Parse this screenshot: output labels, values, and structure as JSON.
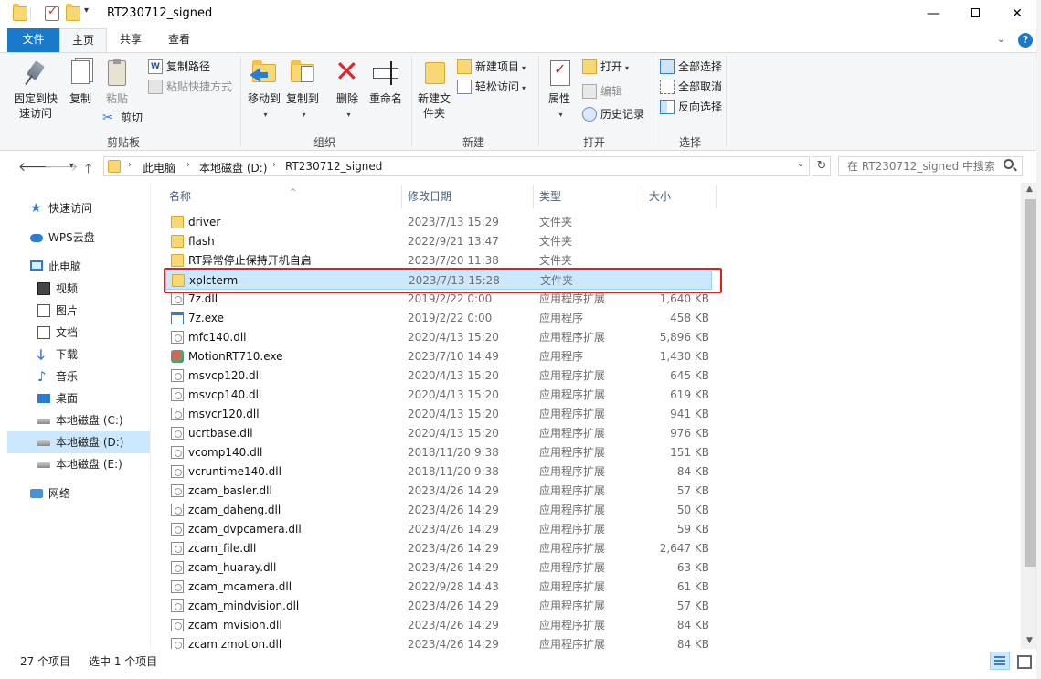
{
  "window": {
    "title": "RT230712_signed",
    "minimize": "—",
    "close": "✕"
  },
  "ribbon_tabs": [
    "文件",
    "主页",
    "共享",
    "查看"
  ],
  "ribbon": {
    "clipboard": {
      "label": "剪贴板",
      "pin": "固定到快速访问",
      "copy": "复制",
      "paste": "粘贴",
      "copy_path": "复制路径",
      "paste_shortcut": "粘贴快捷方式",
      "cut": "剪切"
    },
    "organize": {
      "label": "组织",
      "move_to": "移动到",
      "copy_to": "复制到",
      "delete": "删除",
      "rename": "重命名"
    },
    "new": {
      "label": "新建",
      "new_folder": "新建文件夹",
      "new_item": "新建项目",
      "easy_access": "轻松访问"
    },
    "open": {
      "label": "打开",
      "properties": "属性",
      "open": "打开",
      "edit": "编辑",
      "history": "历史记录"
    },
    "select": {
      "label": "选择",
      "select_all": "全部选择",
      "select_none": "全部取消",
      "invert": "反向选择"
    }
  },
  "address": {
    "crumbs": [
      "此电脑",
      "本地磁盘 (D:)",
      "RT230712_signed"
    ],
    "search_placeholder": "在 RT230712_signed 中搜索"
  },
  "nav": {
    "quick_access": "快速访问",
    "wps_cloud": "WPS云盘",
    "this_pc": "此电脑",
    "videos": "视频",
    "pictures": "图片",
    "documents": "文档",
    "downloads": "下载",
    "music": "音乐",
    "desktop": "桌面",
    "drive_c": "本地磁盘 (C:)",
    "drive_d": "本地磁盘 (D:)",
    "drive_e": "本地磁盘 (E:)",
    "network": "网络"
  },
  "columns": {
    "name": "名称",
    "date": "修改日期",
    "type": "类型",
    "size": "大小"
  },
  "files": [
    {
      "name": "driver",
      "date": "2023/7/13 15:29",
      "type": "文件夹",
      "size": "",
      "icon": "folder-icon"
    },
    {
      "name": "flash",
      "date": "2022/9/21 13:47",
      "type": "文件夹",
      "size": "",
      "icon": "folder-icon"
    },
    {
      "name": "RT异常停止保持开机自启",
      "date": "2023/7/20 11:38",
      "type": "文件夹",
      "size": "",
      "icon": "folder-icon"
    },
    {
      "name": "xplcterm",
      "date": "2023/7/13 15:28",
      "type": "文件夹",
      "size": "",
      "icon": "folder-icon"
    },
    {
      "name": "7z.dll",
      "date": "2019/2/22 0:00",
      "type": "应用程序扩展",
      "size": "1,640 KB",
      "icon": "dll-icon"
    },
    {
      "name": "7z.exe",
      "date": "2019/2/22 0:00",
      "type": "应用程序",
      "size": "458 KB",
      "icon": "exe-icon"
    },
    {
      "name": "mfc140.dll",
      "date": "2020/4/13 15:20",
      "type": "应用程序扩展",
      "size": "5,896 KB",
      "icon": "dll-icon"
    },
    {
      "name": "MotionRT710.exe",
      "date": "2023/7/10 14:49",
      "type": "应用程序",
      "size": "1,430 KB",
      "icon": "app-icon"
    },
    {
      "name": "msvcp120.dll",
      "date": "2020/4/13 15:20",
      "type": "应用程序扩展",
      "size": "645 KB",
      "icon": "dll-icon"
    },
    {
      "name": "msvcp140.dll",
      "date": "2020/4/13 15:20",
      "type": "应用程序扩展",
      "size": "619 KB",
      "icon": "dll-icon"
    },
    {
      "name": "msvcr120.dll",
      "date": "2020/4/13 15:20",
      "type": "应用程序扩展",
      "size": "941 KB",
      "icon": "dll-icon"
    },
    {
      "name": "ucrtbase.dll",
      "date": "2020/4/13 15:20",
      "type": "应用程序扩展",
      "size": "976 KB",
      "icon": "dll-icon"
    },
    {
      "name": "vcomp140.dll",
      "date": "2018/11/20 9:38",
      "type": "应用程序扩展",
      "size": "151 KB",
      "icon": "dll-icon"
    },
    {
      "name": "vcruntime140.dll",
      "date": "2018/11/20 9:38",
      "type": "应用程序扩展",
      "size": "84 KB",
      "icon": "dll-icon"
    },
    {
      "name": "zcam_basler.dll",
      "date": "2023/4/26 14:29",
      "type": "应用程序扩展",
      "size": "57 KB",
      "icon": "dll-icon"
    },
    {
      "name": "zcam_daheng.dll",
      "date": "2023/4/26 14:29",
      "type": "应用程序扩展",
      "size": "50 KB",
      "icon": "dll-icon"
    },
    {
      "name": "zcam_dvpcamera.dll",
      "date": "2023/4/26 14:29",
      "type": "应用程序扩展",
      "size": "59 KB",
      "icon": "dll-icon"
    },
    {
      "name": "zcam_file.dll",
      "date": "2023/4/26 14:29",
      "type": "应用程序扩展",
      "size": "2,647 KB",
      "icon": "dll-icon"
    },
    {
      "name": "zcam_huaray.dll",
      "date": "2023/4/26 14:29",
      "type": "应用程序扩展",
      "size": "63 KB",
      "icon": "dll-icon"
    },
    {
      "name": "zcam_mcamera.dll",
      "date": "2022/9/28 14:43",
      "type": "应用程序扩展",
      "size": "61 KB",
      "icon": "dll-icon"
    },
    {
      "name": "zcam_mindvision.dll",
      "date": "2023/4/26 14:29",
      "type": "应用程序扩展",
      "size": "57 KB",
      "icon": "dll-icon"
    },
    {
      "name": "zcam_mvision.dll",
      "date": "2023/4/26 14:29",
      "type": "应用程序扩展",
      "size": "84 KB",
      "icon": "dll-icon"
    },
    {
      "name": "zcam zmotion.dll",
      "date": "2023/4/26 14:29",
      "type": "应用程序扩展",
      "size": "84 KB",
      "icon": "dll-icon"
    }
  ],
  "selected_file": "xplcterm",
  "status": {
    "item_count": "27 个项目",
    "selected": "选中 1 个项目"
  }
}
